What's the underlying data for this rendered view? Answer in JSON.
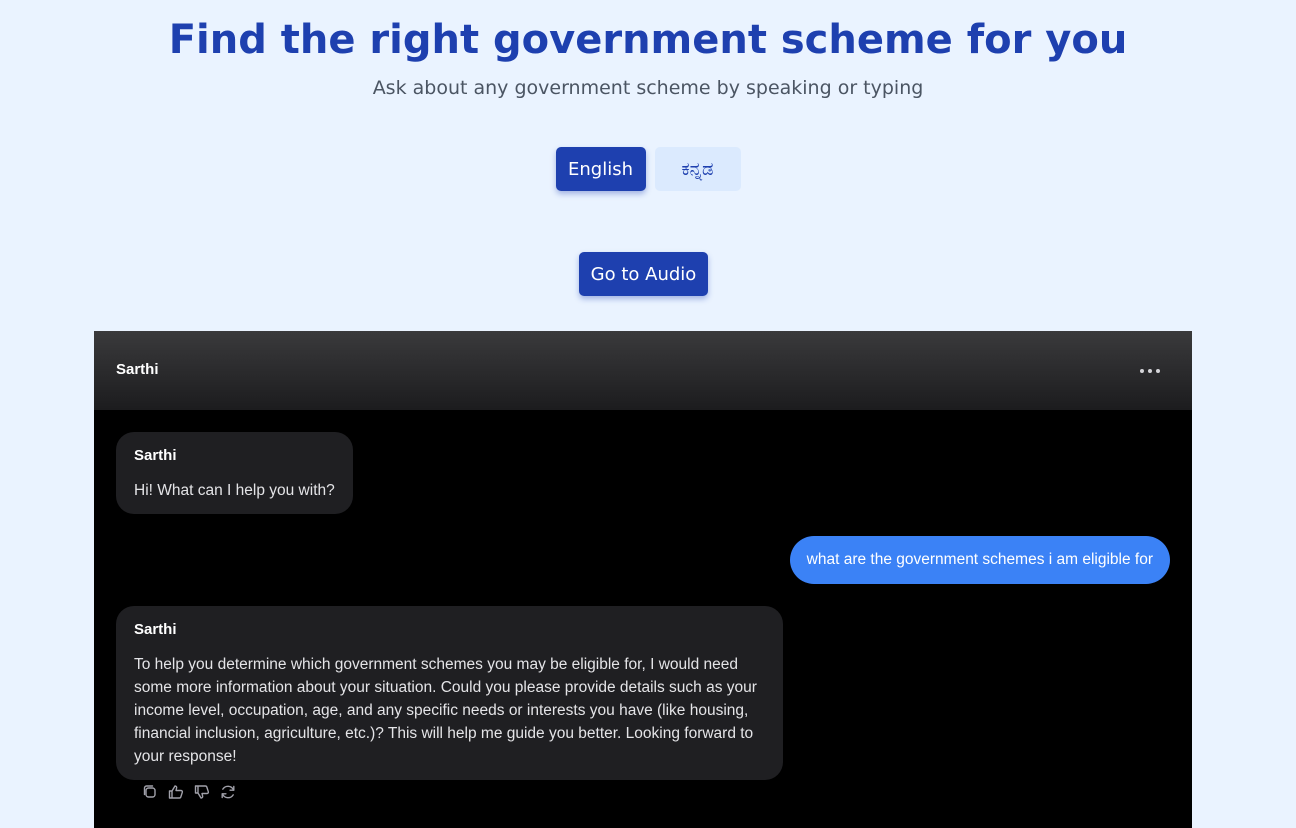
{
  "header": {
    "title": "Find the right government scheme for you",
    "subtitle": "Ask about any government scheme by speaking or typing"
  },
  "languages": {
    "selected": "English",
    "options": [
      "English",
      "ಕನ್ನಡ"
    ]
  },
  "audio_button_label": "Go to Audio",
  "chat": {
    "title": "Sarthi",
    "menu_icon": "more-horizontal-icon",
    "messages": [
      {
        "role": "bot",
        "sender": "Sarthi",
        "text": "Hi! What can I help you with?"
      },
      {
        "role": "user",
        "text": "what are the government schemes i am eligible for"
      },
      {
        "role": "bot",
        "sender": "Sarthi",
        "text": "To help you determine which government schemes you may be eligible for, I would need some more information about your situation. Could you please provide details such as your income level, occupation, age, and any specific needs or interests you have (like housing, financial inclusion, agriculture, etc.)? This will help me guide you better. Looking forward to your response!"
      }
    ],
    "message_actions": [
      "copy-icon",
      "thumbs-up-icon",
      "thumbs-down-icon",
      "regenerate-icon"
    ]
  },
  "colors": {
    "page_background": "#eaf3ff",
    "primary": "#1e40af",
    "secondary_button": "#dbeafe",
    "chat_background": "#000000",
    "bot_bubble": "#1f1f22",
    "user_bubble": "#3b82f6"
  }
}
